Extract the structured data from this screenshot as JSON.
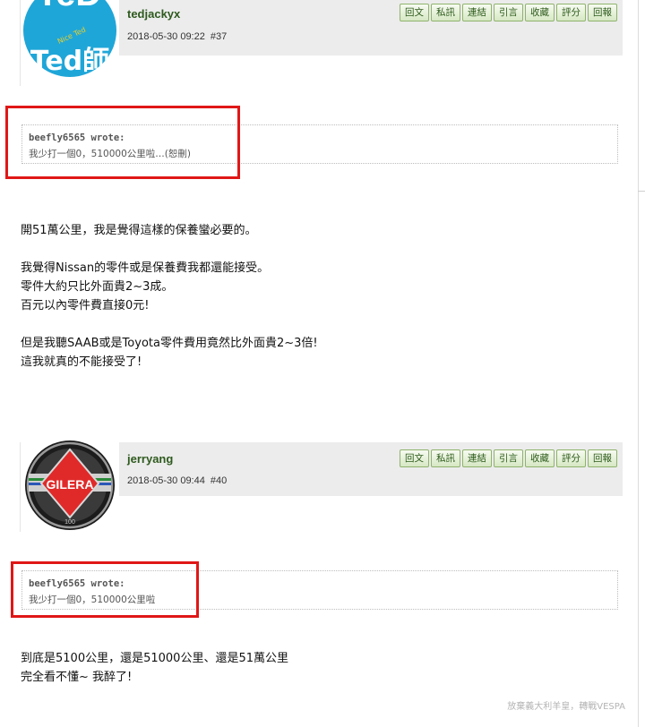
{
  "actions": [
    "回文",
    "私訊",
    "連結",
    "引言",
    "收藏",
    "評分",
    "回報"
  ],
  "posts": [
    {
      "username": "tedjackyx",
      "date": "2018-05-30 09:22",
      "floor": "#37",
      "avatar_text": "Ted師",
      "avatar_small": "Nice Ted",
      "quote_author": "beefly6565 wrote:",
      "quote_text": "我少打一個0，510000公里啦…(恕刪)",
      "body": [
        "開51萬公里，我是覺得這樣的保養蠻必要的。",
        "",
        "我覺得Nissan的零件或是保養費我都還能接受。",
        "零件大約只比外面貴2~3成。",
        "百元以內零件費直接0元!",
        "",
        "但是我聽SAAB或是Toyota零件費用竟然比外面貴2~3倍!",
        "這我就真的不能接受了!"
      ]
    },
    {
      "username": "jerryang",
      "date": "2018-05-30 09:44",
      "floor": "#40",
      "avatar_text": "GILERA",
      "avatar_small": "100",
      "quote_author": "beefly6565 wrote:",
      "quote_text": "我少打一個0，510000公里啦",
      "body": [
        "到底是5100公里，還是51000公里、還是51萬公里",
        "完全看不懂~ 我醉了!"
      ]
    }
  ],
  "watermark": "放棄義大利羊皇，轉戰VESPA",
  "colors": {
    "header_bg": "#ececec",
    "username": "#2e5a1e",
    "highlight_box": "#e01717",
    "button_border": "#8fb36d"
  }
}
